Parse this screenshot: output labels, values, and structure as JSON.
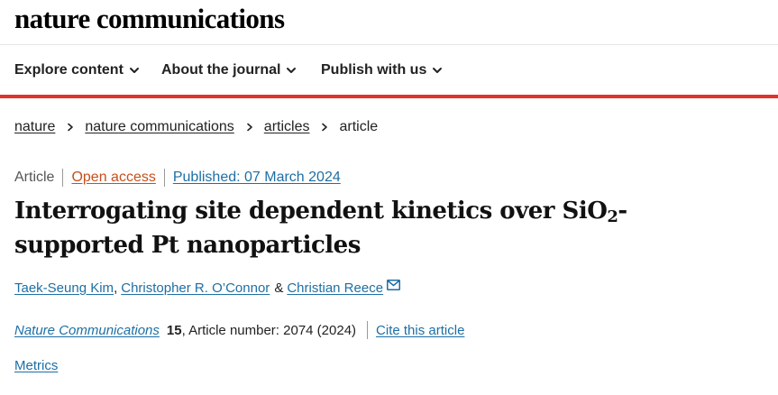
{
  "header": {
    "logo": "nature communications"
  },
  "nav": {
    "items": [
      {
        "label": "Explore content",
        "icon": "chevron-down-icon"
      },
      {
        "label": "About the journal",
        "icon": "chevron-down-icon"
      },
      {
        "label": "Publish with us",
        "icon": "chevron-down-icon"
      }
    ],
    "accent_color": "#e0352b"
  },
  "breadcrumb": {
    "items": [
      "nature",
      "nature communications",
      "articles"
    ],
    "current": "article"
  },
  "article": {
    "type": "Article",
    "access": "Open access",
    "published": "Published: 07 March 2024",
    "title_part1": "Interrogating site dependent kinetics over SiO",
    "title_sub": "2",
    "title_part2": "-supported Pt nanoparticles",
    "authors": [
      "Taek-Seung Kim",
      "Christopher R. O’Connor",
      "Christian Reece"
    ],
    "author_sep_1": ",",
    "author_sep_2": "&",
    "journal": "Nature Communications",
    "volume": "15",
    "article_number": ", Article number: 2074 (2024)",
    "cite_label": "Cite this article",
    "metrics_label": "Metrics"
  },
  "colors": {
    "link": "#1d6fa5",
    "open_access": "#c4501c"
  }
}
